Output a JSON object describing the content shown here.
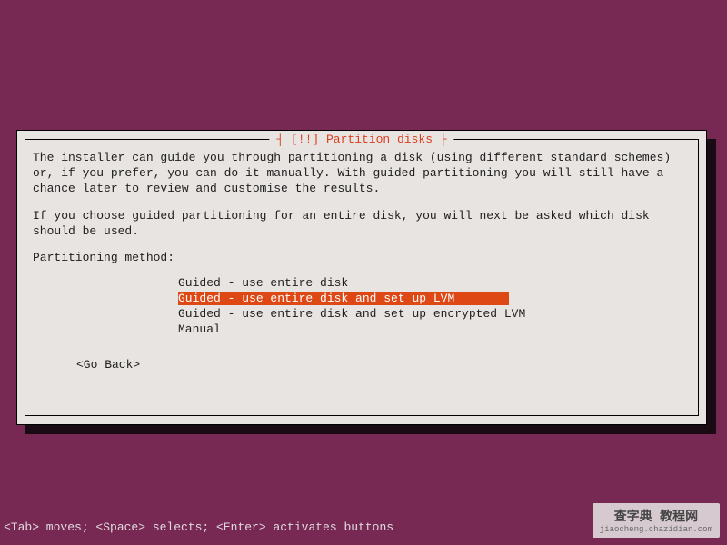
{
  "dialog": {
    "title_decoration_left": "┤",
    "title_decoration_right": "├",
    "title": "[!!] Partition disks",
    "description_line1": "The installer can guide you through partitioning a disk (using different standard schemes) or, if you prefer, you can do it manually. With guided partitioning you will still have a chance later to review and customise the results.",
    "description_line2": "If you choose guided partitioning for an entire disk, you will next be asked which disk should be used.",
    "prompt": "Partitioning method:",
    "options": [
      "Guided - use entire disk",
      "Guided - use entire disk and set up LVM",
      "Guided - use entire disk and set up encrypted LVM",
      "Manual"
    ],
    "selected_index": 1,
    "go_back": "<Go Back>"
  },
  "footer": {
    "hint": "<Tab> moves; <Space> selects; <Enter> activates buttons"
  },
  "watermark": {
    "main": "查字典 教程网",
    "sub": "jiaocheng.chazidian.com"
  }
}
